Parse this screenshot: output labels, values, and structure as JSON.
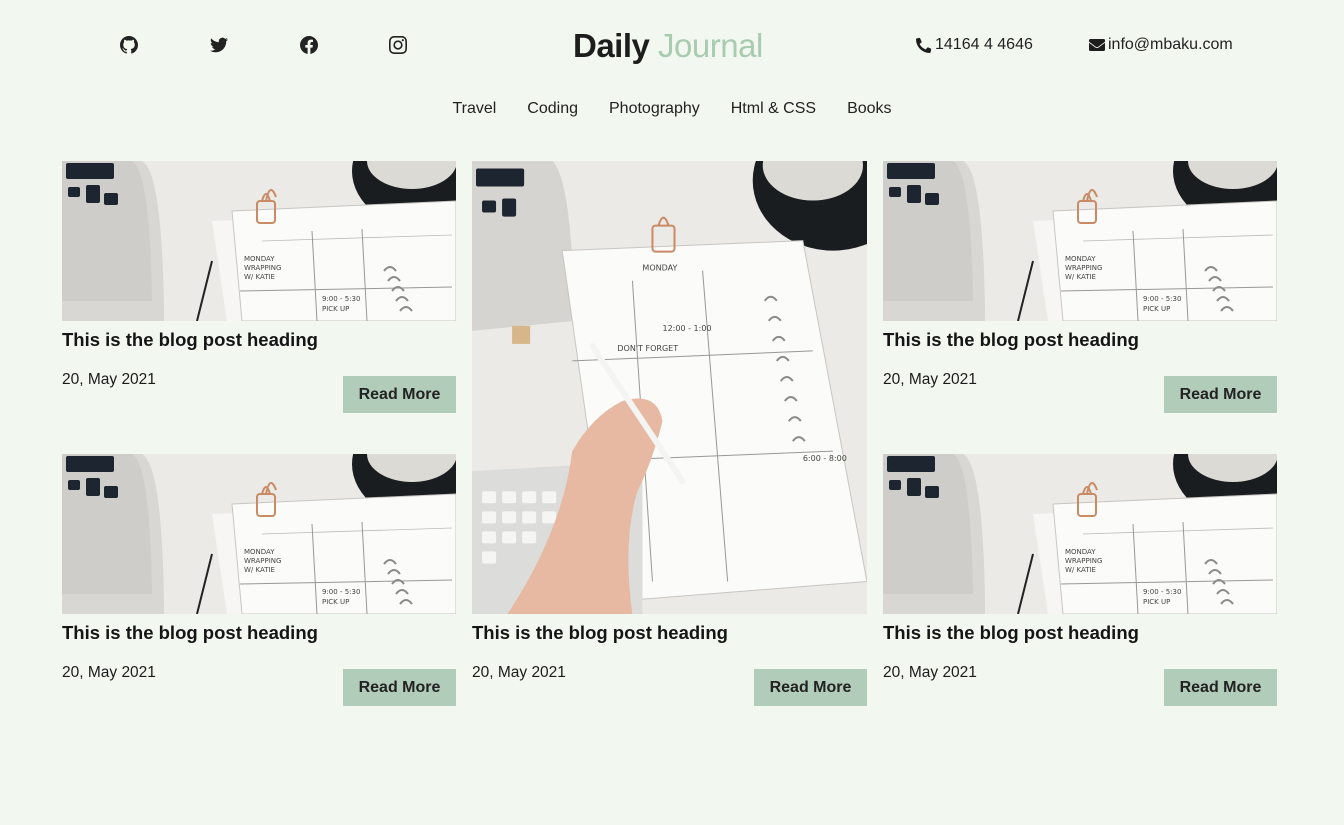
{
  "header": {
    "brand_part1": "Daily",
    "brand_part2": "Journal",
    "phone": "14164 4 4646",
    "email": "info@mbaku.com",
    "social": [
      "github-icon",
      "twitter-icon",
      "facebook-icon",
      "instagram-icon"
    ]
  },
  "nav": {
    "items": [
      {
        "label": "Travel"
      },
      {
        "label": "Coding"
      },
      {
        "label": "Photography"
      },
      {
        "label": "Html & CSS"
      },
      {
        "label": "Books"
      }
    ]
  },
  "posts": [
    {
      "heading": "This is the blog post heading",
      "date": "20, May 2021",
      "button": "Read More"
    },
    {
      "heading": "This is the blog post heading",
      "date": "20, May 2021",
      "button": "Read More"
    },
    {
      "heading": "This is the blog post heading",
      "date": "20, May 2021",
      "button": "Read More"
    },
    {
      "heading": "This is the blog post heading",
      "date": "20, May 2021",
      "button": "Read More"
    },
    {
      "heading": "This is the blog post heading",
      "date": "20, May 2021",
      "button": "Read More"
    }
  ],
  "colors": {
    "background": "#f2f8ef",
    "accent": "#b2ccba",
    "brand_light": "#a9cbb0"
  }
}
